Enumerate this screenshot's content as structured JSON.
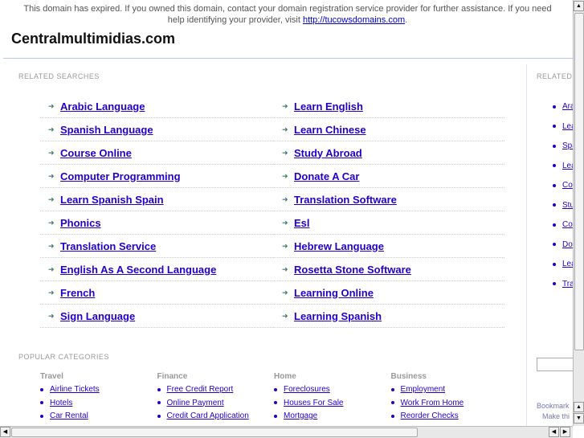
{
  "notice": {
    "text": "This domain has expired. If you owned this domain, contact your domain registration service provider for further assistance. If you need help identifying your provider, visit ",
    "link": "http://tucowsdomains.com",
    "end": "."
  },
  "site_title": "Centralmultimidias.com",
  "related": {
    "heading": "RELATED SEARCHES",
    "col1": [
      "Arabic Language",
      "Spanish Language",
      "Course Online",
      "Computer Programming",
      "Learn Spanish Spain",
      "Phonics",
      "Translation Service",
      "English As A Second Language",
      "French",
      "Sign Language"
    ],
    "col2": [
      "Learn English",
      "Learn Chinese",
      "Study Abroad",
      "Donate A Car",
      "Translation Software",
      "Esl",
      "Hebrew Language",
      "Rosetta Stone Software",
      "Learning Online",
      "Learning Spanish"
    ]
  },
  "popular": {
    "heading": "POPULAR CATEGORIES",
    "categories": [
      {
        "name": "Travel",
        "items": [
          "Airline Tickets",
          "Hotels",
          "Car Rental"
        ]
      },
      {
        "name": "Finance",
        "items": [
          "Free Credit Report",
          "Online Payment",
          "Credit Card Application"
        ]
      },
      {
        "name": "Home",
        "items": [
          "Foreclosures",
          "Houses For Sale",
          "Mortgage"
        ]
      },
      {
        "name": "Business",
        "items": [
          "Employment",
          "Work From Home",
          "Reorder Checks"
        ]
      }
    ]
  },
  "sidebar": {
    "heading": "RELATED",
    "items": [
      "Ara",
      "Lea",
      "Spa",
      "Lea",
      "Co",
      "Stu",
      "Co",
      "Do",
      "Lea",
      "Tra"
    ],
    "bookmark": "Bookmark",
    "make": "Make thi"
  },
  "colors": {
    "link": "#2200cc",
    "arrow": "#3a7a6a"
  }
}
